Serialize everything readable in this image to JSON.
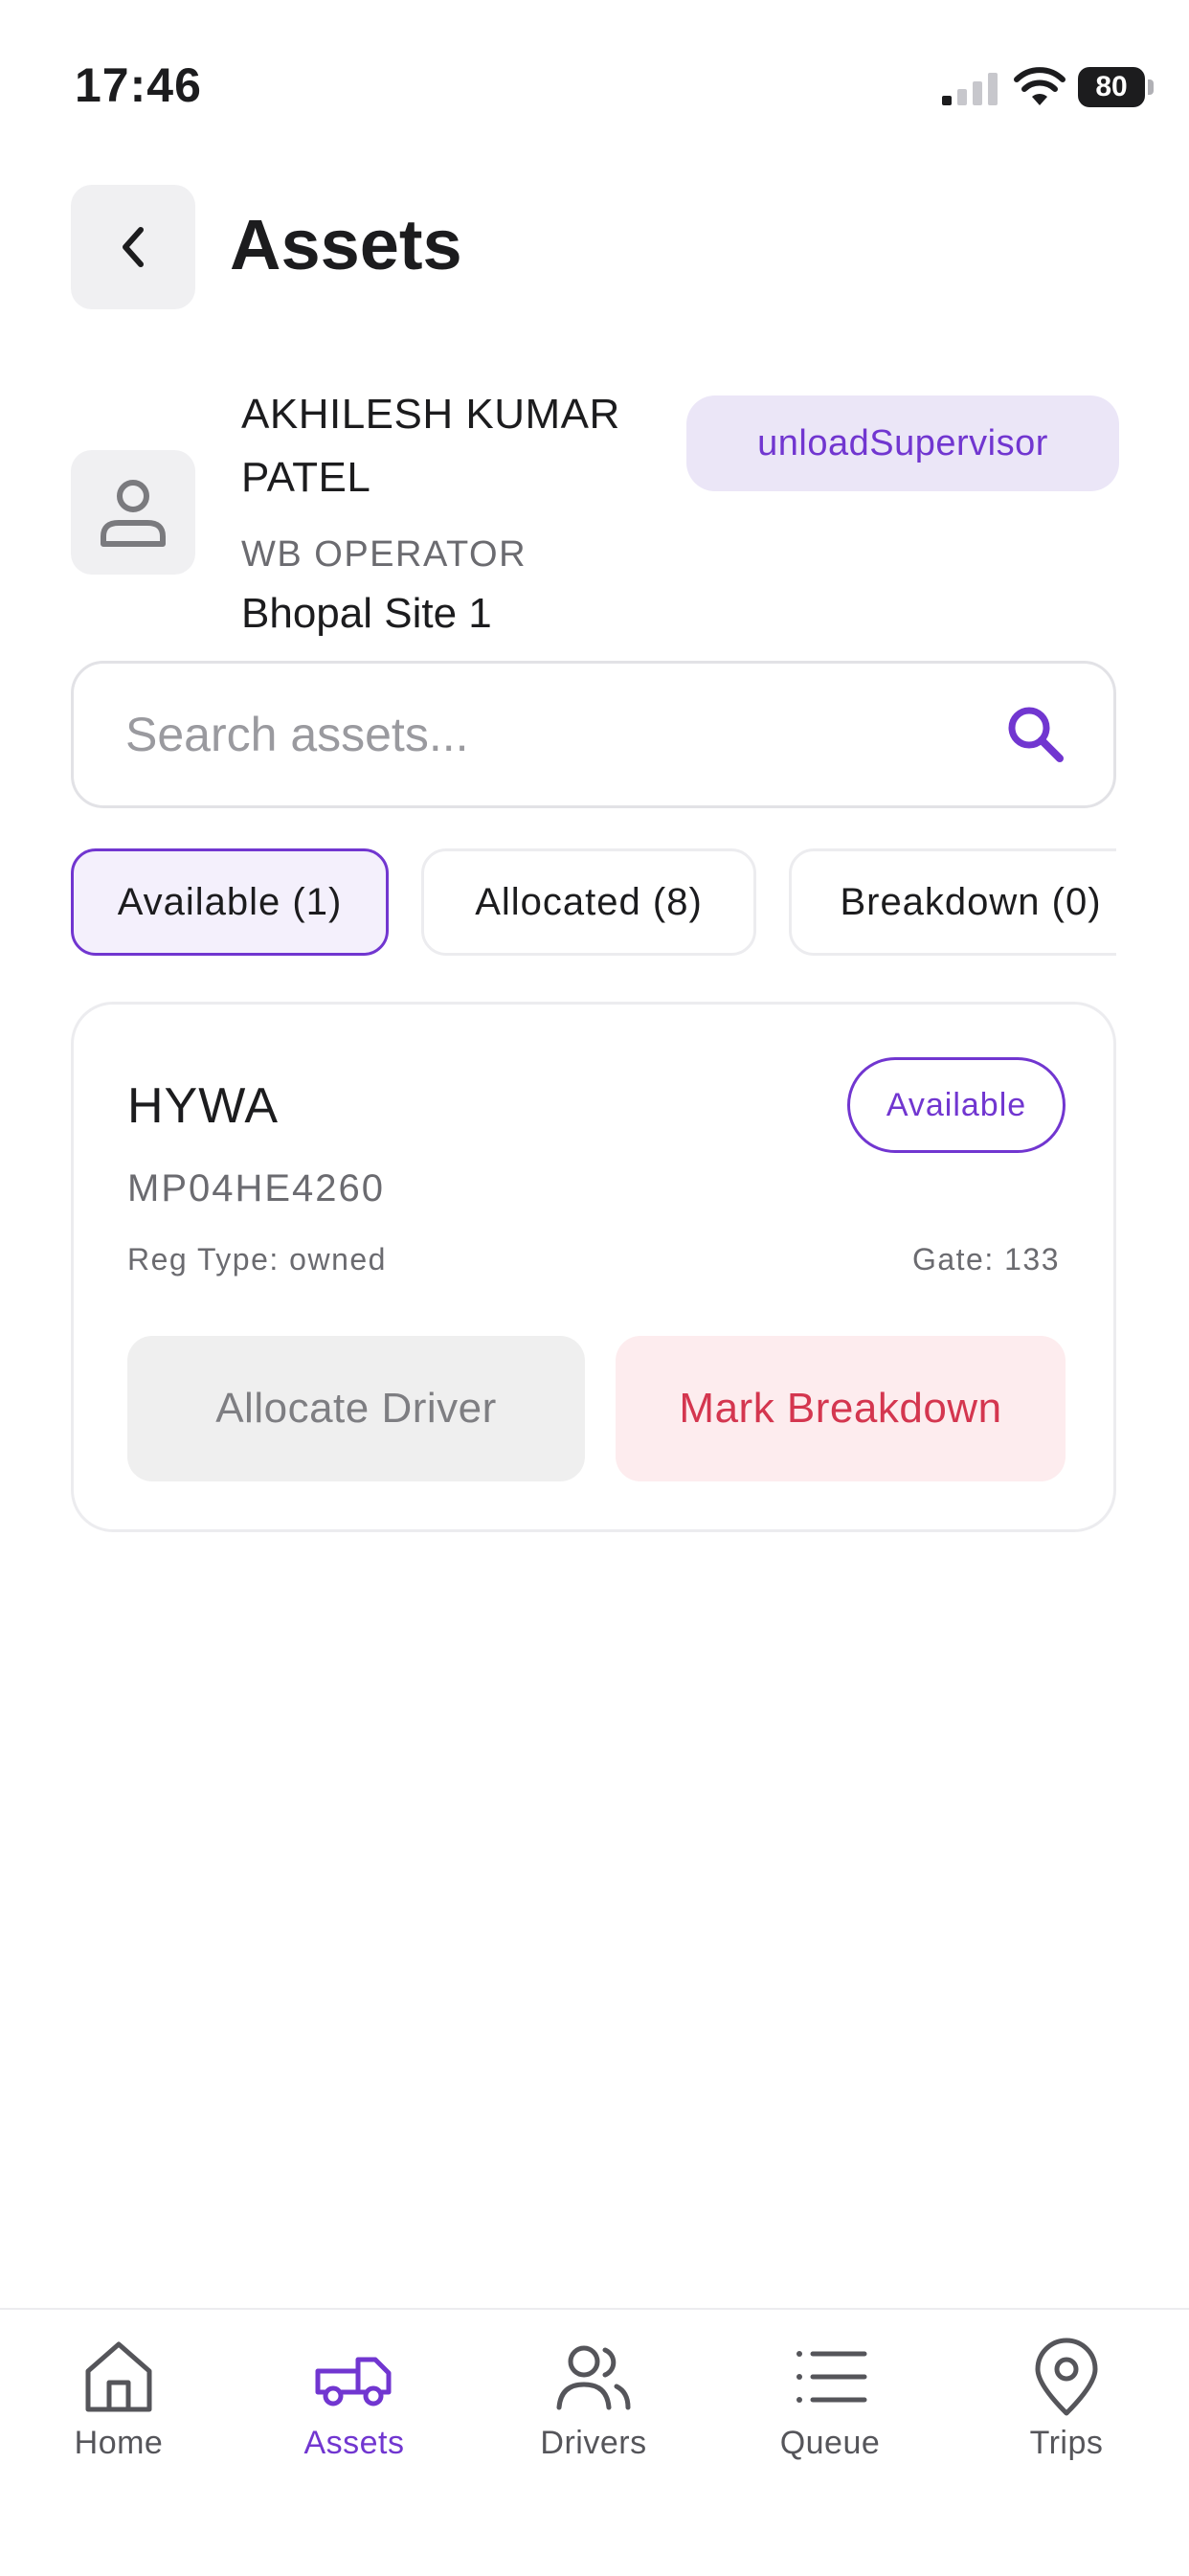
{
  "status_bar": {
    "time": "17:46",
    "battery": "80"
  },
  "header": {
    "title": "Assets"
  },
  "profile": {
    "name": "AKHILESH KUMAR PATEL",
    "role": "WB OPERATOR",
    "site": "Bhopal Site 1",
    "badge": "unloadSupervisor"
  },
  "search": {
    "placeholder": "Search assets...",
    "value": ""
  },
  "filters": [
    {
      "label": "Available (1)",
      "active": true
    },
    {
      "label": "Allocated (8)",
      "active": false
    },
    {
      "label": "Breakdown (0)",
      "active": false
    }
  ],
  "asset": {
    "name": "HYWA",
    "status": "Available",
    "reg_no": "MP04HE4260",
    "reg_type": "Reg Type: owned",
    "gate": "Gate: 133",
    "allocate_label": "Allocate Driver",
    "breakdown_label": "Mark Breakdown"
  },
  "nav": [
    {
      "label": "Home",
      "icon": "home-icon",
      "active": false
    },
    {
      "label": "Assets",
      "icon": "truck-icon",
      "active": true
    },
    {
      "label": "Drivers",
      "icon": "users-icon",
      "active": false
    },
    {
      "label": "Queue",
      "icon": "list-icon",
      "active": false
    },
    {
      "label": "Trips",
      "icon": "map-pin-icon",
      "active": false
    }
  ],
  "colors": {
    "accent": "#7136d0",
    "accent_bg": "#ebe6f7",
    "danger": "#d4364f",
    "danger_bg": "#fdecee"
  }
}
